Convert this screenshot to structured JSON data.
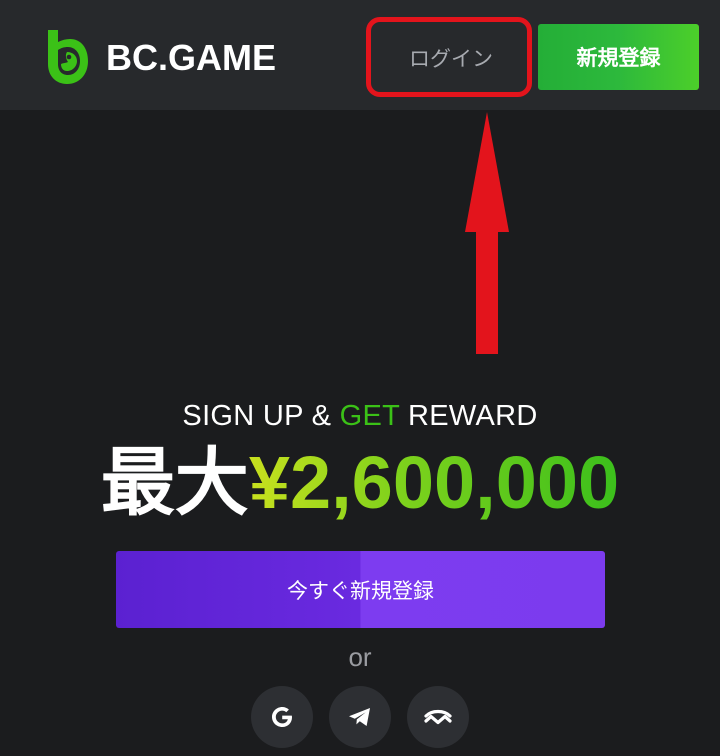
{
  "header": {
    "brand": "BC.GAME",
    "login_label": "ログイン",
    "signup_label": "新規登録"
  },
  "hero": {
    "tagline_part1": "SIGN UP & ",
    "tagline_highlight": "GET",
    "tagline_part2": " REWARD",
    "max_label": "最大",
    "amount": "¥2,600,000",
    "cta_label": "今すぐ新規登録",
    "or_label": "or"
  },
  "social": [
    {
      "icon": "google-icon"
    },
    {
      "icon": "telegram-icon"
    },
    {
      "icon": "walletconnect-icon"
    }
  ],
  "colors": {
    "background": "#1b1c1e",
    "header": "#27292c",
    "accent_green": "#3bc117",
    "cta_purple": "#6a2ae0",
    "annotation_red": "#e3141c"
  }
}
